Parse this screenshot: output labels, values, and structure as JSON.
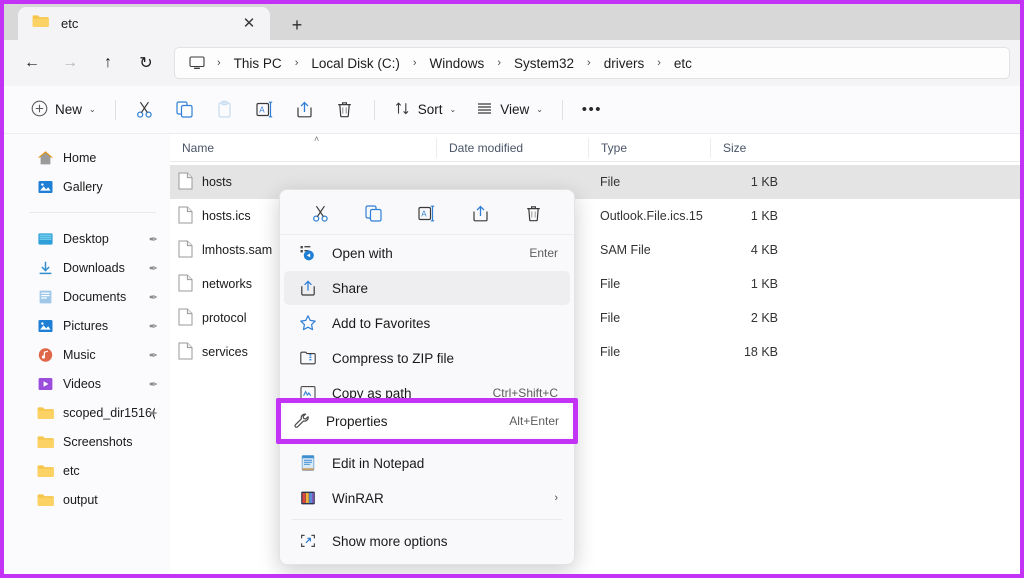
{
  "window": {
    "tab": {
      "label": "etc",
      "icon": "folder-icon",
      "close_label": "✕"
    },
    "new_tab_label": "+",
    "annotation_color": "#c233f5"
  },
  "navbar": {
    "back": "←",
    "forward": "→",
    "up": "↑",
    "refresh": "↻",
    "breadcrumb": [
      "This PC",
      "Local Disk (C:)",
      "Windows",
      "System32",
      "drivers",
      "etc"
    ],
    "separator": "›",
    "root_icon": "this-pc-icon"
  },
  "toolbar": {
    "new_label": "New",
    "cut_label": "Cut",
    "copy_label": "Copy",
    "paste_label": "Paste",
    "rename_label": "Rename",
    "share_label": "Share",
    "delete_label": "Delete",
    "sort_label": "Sort",
    "view_label": "View",
    "more_label": "•••",
    "caret": "⌄"
  },
  "sidebar": {
    "top_items": [
      {
        "label": "Home",
        "icon": "home-icon"
      },
      {
        "label": "Gallery",
        "icon": "gallery-icon"
      }
    ],
    "items": [
      {
        "label": "Desktop",
        "icon": "desktop-icon",
        "pinned": true
      },
      {
        "label": "Downloads",
        "icon": "downloads-icon",
        "pinned": true
      },
      {
        "label": "Documents",
        "icon": "documents-icon",
        "pinned": true
      },
      {
        "label": "Pictures",
        "icon": "pictures-icon",
        "pinned": true
      },
      {
        "label": "Music",
        "icon": "music-icon",
        "pinned": true
      },
      {
        "label": "Videos",
        "icon": "videos-icon",
        "pinned": true
      },
      {
        "label": "scoped_dir1516(",
        "icon": "folder-icon",
        "pinned": true
      },
      {
        "label": "Screenshots",
        "icon": "folder-icon",
        "pinned": false
      },
      {
        "label": "etc",
        "icon": "folder-icon",
        "pinned": false
      },
      {
        "label": "output",
        "icon": "folder-icon",
        "pinned": false
      }
    ],
    "pin_glyph": "✒"
  },
  "filelist": {
    "columns": [
      "Name",
      "Date modified",
      "Type",
      "Size"
    ],
    "sort_indicator": "˄",
    "rows": [
      {
        "name": "hosts",
        "date": "",
        "type": "File",
        "size": "1 KB",
        "selected": true
      },
      {
        "name": "hosts.ics",
        "date": "",
        "type": "Outlook.File.ics.15",
        "size": "1 KB",
        "selected": false
      },
      {
        "name": "lmhosts.sam",
        "date": "",
        "type": "SAM File",
        "size": "4 KB",
        "selected": false
      },
      {
        "name": "networks",
        "date": "",
        "type": "File",
        "size": "1 KB",
        "selected": false
      },
      {
        "name": "protocol",
        "date": "",
        "type": "File",
        "size": "2 KB",
        "selected": false
      },
      {
        "name": "services",
        "date": "",
        "type": "File",
        "size": "18 KB",
        "selected": false
      }
    ]
  },
  "context_menu": {
    "icon_row": [
      {
        "name": "cut-icon",
        "label": "Cut"
      },
      {
        "name": "copy-icon",
        "label": "Copy"
      },
      {
        "name": "rename-icon",
        "label": "Rename"
      },
      {
        "name": "share-icon",
        "label": "Share"
      },
      {
        "name": "delete-icon",
        "label": "Delete"
      }
    ],
    "items": [
      {
        "label": "Open with",
        "accel": "Enter",
        "icon": "open-with-icon",
        "highlighted": false,
        "submenu": false
      },
      {
        "label": "Share",
        "accel": "",
        "icon": "share-icon",
        "highlighted": true,
        "submenu": false
      },
      {
        "label": "Add to Favorites",
        "accel": "",
        "icon": "star-icon",
        "highlighted": false,
        "submenu": false
      },
      {
        "label": "Compress to ZIP file",
        "accel": "",
        "icon": "zip-icon",
        "highlighted": false,
        "submenu": false
      },
      {
        "label": "Copy as path",
        "accel": "Ctrl+Shift+C",
        "icon": "copy-path-icon",
        "highlighted": false,
        "submenu": false
      },
      {
        "label": "Properties",
        "accel": "Alt+Enter",
        "icon": "wrench-icon",
        "highlighted": false,
        "submenu": false
      },
      {
        "label": "Edit in Notepad",
        "accel": "",
        "icon": "notepad-icon",
        "highlighted": false,
        "submenu": false
      },
      {
        "label": "WinRAR",
        "accel": "",
        "icon": "winrar-icon",
        "highlighted": false,
        "submenu": true
      },
      {
        "label": "Show more options",
        "accel": "",
        "icon": "more-options-icon",
        "highlighted": false,
        "submenu": false
      }
    ],
    "submenu_arrow": "›"
  }
}
